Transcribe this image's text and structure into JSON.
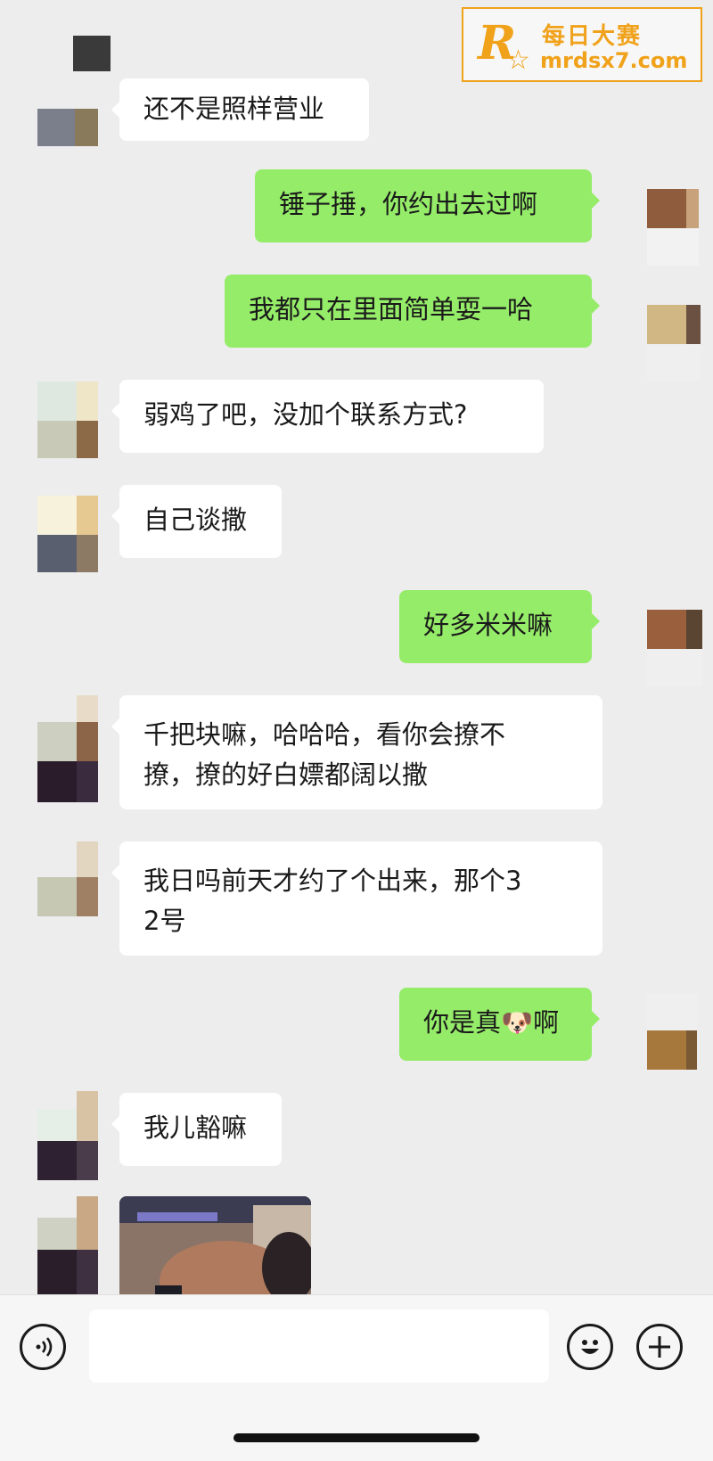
{
  "watermark": {
    "brand_cn": "每日大赛",
    "url": "mrdsx7.com",
    "logo_letter": "R"
  },
  "messages": [
    {
      "side": "in",
      "text": "还不是照样营业"
    },
    {
      "side": "out",
      "text": "锤子捶，你约出去过啊"
    },
    {
      "side": "out",
      "text": "我都只在里面简单耍一哈"
    },
    {
      "side": "in",
      "text": "弱鸡了吧，没加个联系方式?"
    },
    {
      "side": "in",
      "text": "自己谈撒"
    },
    {
      "side": "out",
      "text": "好多米米嘛"
    },
    {
      "side": "in",
      "text": "千把块嘛，哈哈哈，看你会撩不\n撩，撩的好白嫖都阔以撒"
    },
    {
      "side": "in",
      "text": "我日吗前天才约了个出来，那个3\n2号"
    },
    {
      "side": "out",
      "text": "你是真🐶啊"
    },
    {
      "side": "in",
      "text": "我儿豁嘛"
    },
    {
      "side": "in",
      "type": "image",
      "text": ""
    }
  ],
  "input_bar": {
    "voice_icon": "voice-icon",
    "emoji_icon": "emoji-icon",
    "add_icon": "add-icon",
    "input_value": ""
  },
  "colors": {
    "incoming": "#ffffff",
    "outgoing": "#95ec69",
    "background": "#ededed",
    "watermark": "#f0a21b"
  }
}
